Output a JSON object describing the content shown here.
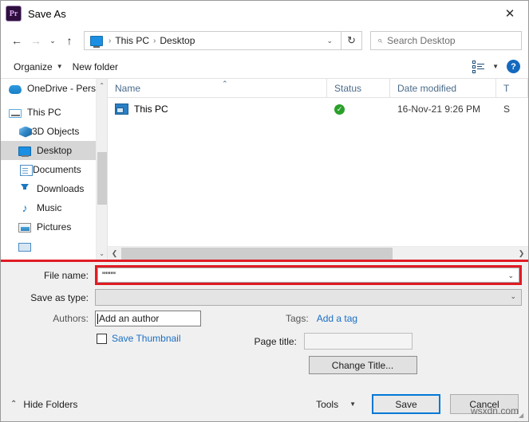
{
  "window": {
    "title": "Save As",
    "app_icon": "Pr",
    "close_label": "✕"
  },
  "nav": {
    "back": "←",
    "forward": "→",
    "recent": "⌄",
    "up": "↑",
    "breadcrumb": [
      "This PC",
      "Desktop"
    ],
    "breadcrumb_separator": "›",
    "address_caret": "⌄",
    "refresh": "↻",
    "search_placeholder": "Search Desktop",
    "search_icon": "⌕"
  },
  "commandbar": {
    "organize": "Organize",
    "organize_caret": "▼",
    "new_folder": "New folder",
    "view_caret": "▼",
    "help": "?"
  },
  "sidebar": {
    "items": [
      {
        "label": "OneDrive - Person",
        "icon": "onedrive-icon",
        "indent": false,
        "selected": false
      },
      {
        "label": "This PC",
        "icon": "this-pc-icon",
        "indent": false,
        "selected": false
      },
      {
        "label": "3D Objects",
        "icon": "3d-objects-icon",
        "indent": true,
        "selected": false
      },
      {
        "label": "Desktop",
        "icon": "desktop-icon",
        "indent": true,
        "selected": true
      },
      {
        "label": "Documents",
        "icon": "documents-icon",
        "indent": true,
        "selected": false
      },
      {
        "label": "Downloads",
        "icon": "downloads-icon",
        "indent": true,
        "selected": false
      },
      {
        "label": "Music",
        "icon": "music-icon",
        "indent": true,
        "selected": false
      },
      {
        "label": "Pictures",
        "icon": "pictures-icon",
        "indent": true,
        "selected": false
      },
      {
        "label": "",
        "icon": "videos-icon",
        "indent": true,
        "selected": false
      }
    ],
    "scroll_up": "⌃",
    "scroll_down": "⌄"
  },
  "filelist": {
    "columns": [
      "Name",
      "Status",
      "Date modified",
      "T"
    ],
    "sort_indicator": "⌃",
    "rows": [
      {
        "name": "This PC",
        "status": "✓",
        "date_modified": "16-Nov-21 9:26 PM",
        "type": "S"
      }
    ],
    "hscroll_left": "❮",
    "hscroll_right": "❯"
  },
  "form": {
    "filename_label": "File name:",
    "filename_value": "\"\"\"\"",
    "filename_caret": "⌄",
    "savetype_label": "Save as type:",
    "savetype_value": "",
    "savetype_caret": "⌄",
    "authors_label": "Authors:",
    "authors_placeholder": "Add an author",
    "tags_label": "Tags:",
    "tags_link": "Add a tag",
    "save_thumbnail_label": "Save Thumbnail",
    "save_thumbnail_checked": false,
    "page_title_label": "Page title:",
    "page_title_value": "",
    "change_title_label": "Change Title..."
  },
  "footer": {
    "hide_folders_caret": "⌃",
    "hide_folders_label": "Hide Folders",
    "tools_label": "Tools",
    "tools_caret": "▼",
    "save_label": "Save",
    "cancel_label": "Cancel",
    "watermark": "wsxdn.com",
    "resize_grip": "◢"
  },
  "colors": {
    "accent": "#0078d7",
    "annotation_red": "#e01b24",
    "link_blue": "#1a6fc4",
    "sync_green": "#2aa02a"
  }
}
